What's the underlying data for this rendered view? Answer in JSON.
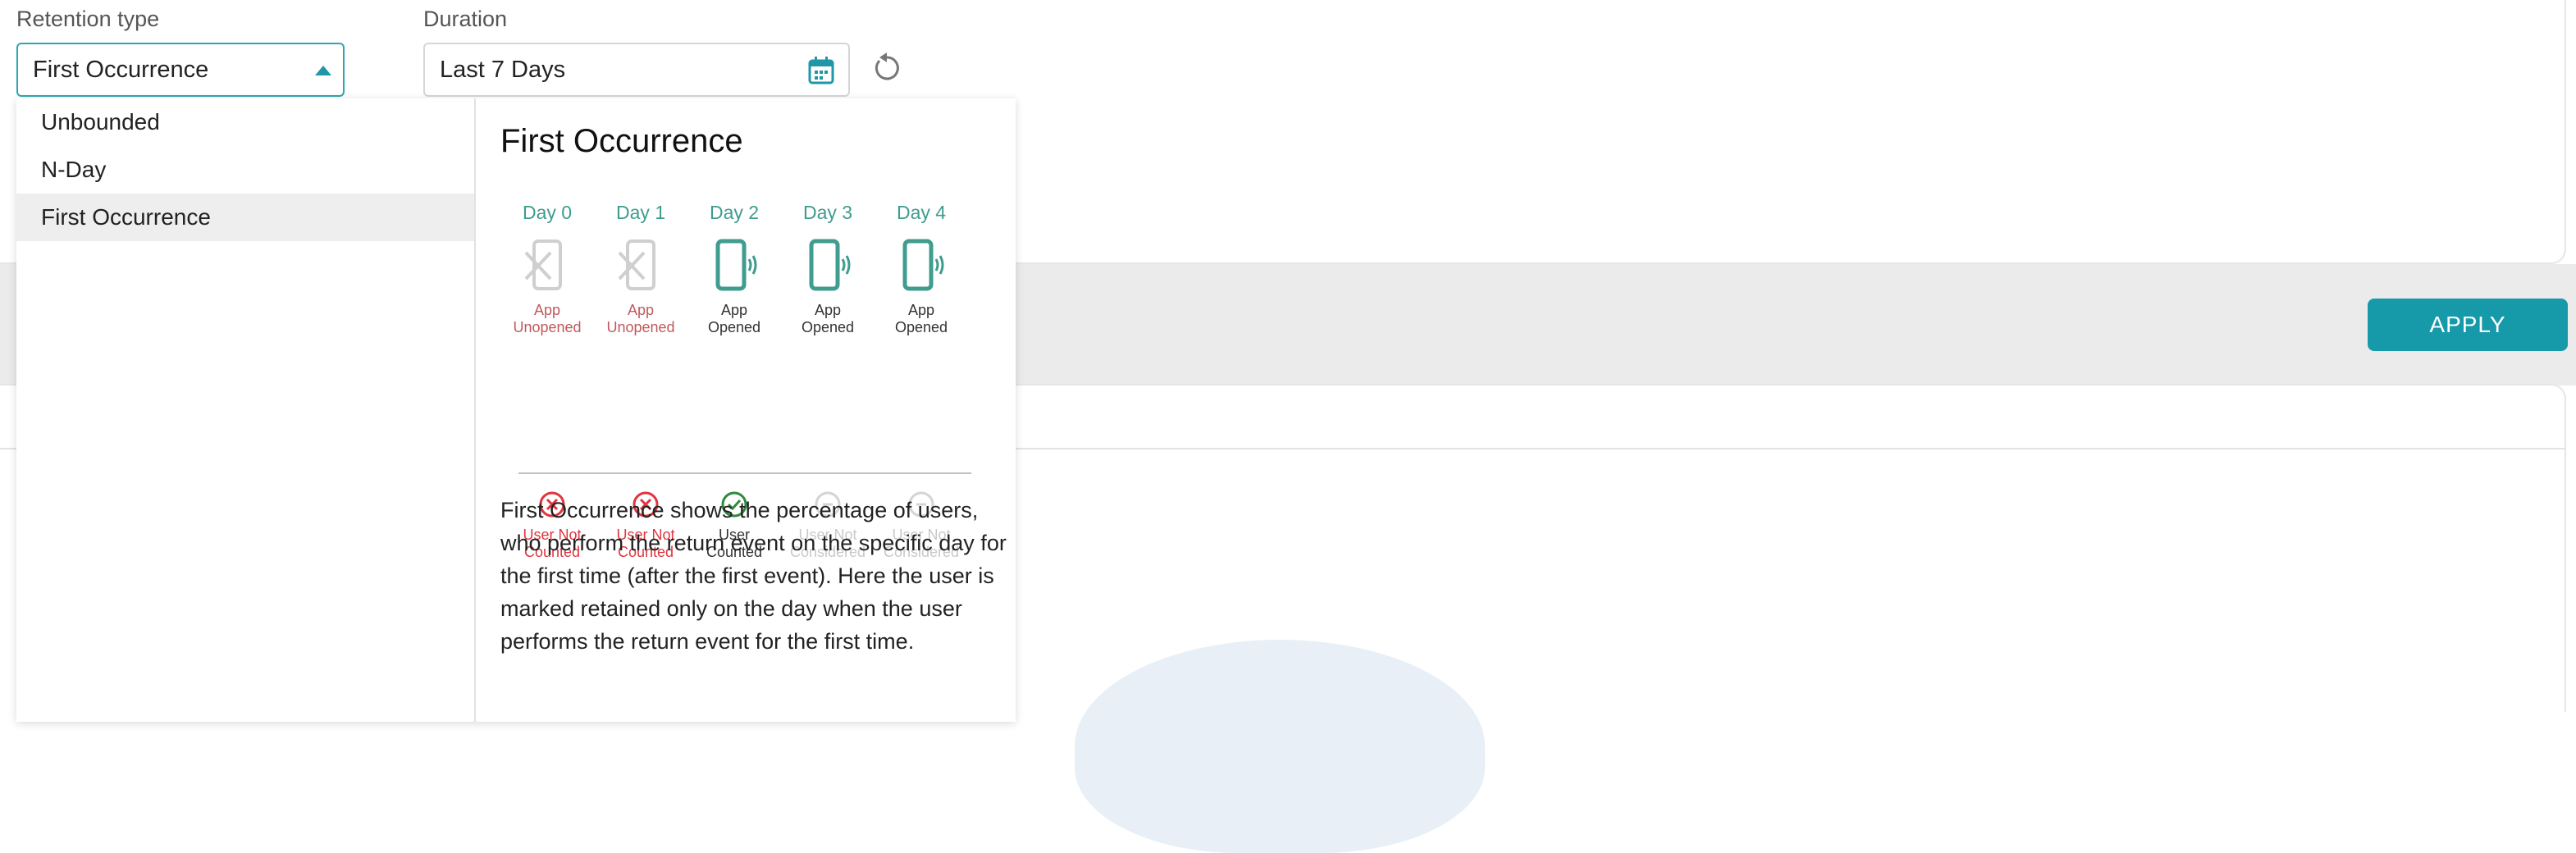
{
  "filters": {
    "retention_type_label": "Retention type",
    "retention_type_value": "First Occurrence",
    "duration_label": "Duration",
    "duration_value": "Last 7 Days"
  },
  "actions": {
    "apply_label": "APPLY"
  },
  "dropdown": {
    "options": [
      {
        "label": "Unbounded",
        "selected": false
      },
      {
        "label": "N-Day",
        "selected": false
      },
      {
        "label": "First Occurrence",
        "selected": true
      }
    ],
    "panel": {
      "title": "First Occurrence",
      "days": [
        {
          "day": "Day 0",
          "state_line1": "App",
          "state_line2": "Unopened",
          "state": "unopened",
          "result_line1": "User Not",
          "result_line2": "Counted",
          "result": "not-counted"
        },
        {
          "day": "Day 1",
          "state_line1": "App",
          "state_line2": "Unopened",
          "state": "unopened",
          "result_line1": "User Not",
          "result_line2": "Counted",
          "result": "not-counted"
        },
        {
          "day": "Day 2",
          "state_line1": "App",
          "state_line2": "Opened",
          "state": "opened",
          "result_line1": "User",
          "result_line2": "Counted",
          "result": "counted"
        },
        {
          "day": "Day 3",
          "state_line1": "App",
          "state_line2": "Opened",
          "state": "opened",
          "result_line1": "User Not",
          "result_line2": "Considered",
          "result": "not-considered"
        },
        {
          "day": "Day 4",
          "state_line1": "App",
          "state_line2": "Opened",
          "state": "opened",
          "result_line1": "User Not",
          "result_line2": "Considered",
          "result": "not-considered"
        }
      ],
      "description": "First Occurrence shows the percentage of users, who perform the return event on the specific day for the first time (after the first event). Here the user is marked retained only on the day when the user performs the return event for the first time."
    }
  },
  "colors": {
    "accent": "#169aaa",
    "teal_icon": "#3f9c8f",
    "red": "#e0353f",
    "green": "#2e8b3e",
    "muted": "#c9c9c9"
  },
  "icons": {
    "retention_caret": "caret-up-icon",
    "duration": "calendar-icon",
    "reset": "reset-icon",
    "opened": "phone-opened-icon",
    "unopened": "phone-unopened-icon",
    "counted": "check-circle-icon",
    "not_counted": "x-circle-icon",
    "not_considered": "minus-circle-icon"
  }
}
